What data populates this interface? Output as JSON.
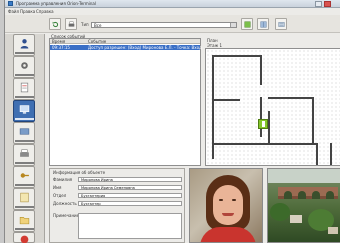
{
  "window": {
    "title": "Программа управления Orion-Terminal",
    "min_glyph": "",
    "close_glyph": ""
  },
  "menu": [
    {
      "label": "Файл"
    },
    {
      "label": "Правка"
    },
    {
      "label": "Справка"
    }
  ],
  "toolbar": {
    "field_label": "Тип",
    "combo_value": "Все",
    "buttons": [
      "refresh-icon",
      "print-icon",
      "export-icon",
      "layout-icon",
      "settings-icon"
    ]
  },
  "nav": {
    "items": [
      "person-icon",
      "settings-icon",
      "document-icon",
      "monitor-icon",
      "card-icon",
      "printer-icon",
      "key-icon",
      "notes-icon",
      "folder-icon",
      "exit-icon"
    ],
    "active_index": 3
  },
  "events": {
    "caption": "Список событий",
    "columns": [
      "Время",
      "Событие"
    ],
    "rows": [
      {
        "time": "09:37:15",
        "text": "Доступ разрешен: (Вход) Миронова Е.Л. - Точка: Вход"
      }
    ]
  },
  "plan": {
    "caption": "План",
    "subcaption": "Этаж 1"
  },
  "info": {
    "caption": "Информация об объекте",
    "fields": [
      {
        "label": "Фамилия",
        "value": "Миронова Ирина"
      },
      {
        "label": "Имя",
        "value": "Миронова Ирина Семеновна"
      },
      {
        "label": "Отдел",
        "value": "Бухгалтерия"
      },
      {
        "label": "Должность",
        "value": "Бухгалтер"
      }
    ],
    "note_label": "Примечание"
  },
  "colors": {
    "accent": "#3a6fc6",
    "marker": "#84c62a"
  }
}
